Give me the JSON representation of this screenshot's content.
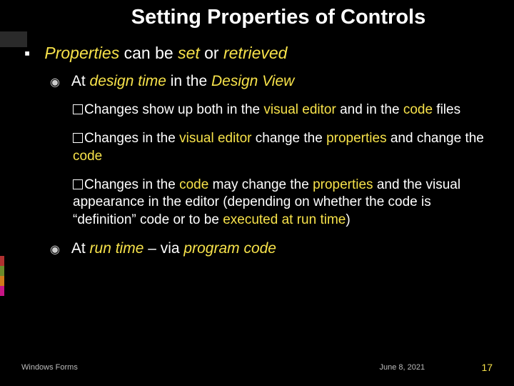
{
  "title": "Setting Properties of Controls",
  "lvl1": {
    "bullet": "▪",
    "pre1": "Properties",
    "mid1": " can be ",
    "pre2": "set",
    "mid2": " or ",
    "pre3": "retrieved"
  },
  "lvl2a": {
    "bullet": "◉",
    "pre": "At ",
    "em1": "design time",
    "mid": " in the ",
    "em2": "Design View"
  },
  "lvl3_items": [
    {
      "segments": [
        {
          "t": "Changes show up both in the ",
          "em": false
        },
        {
          "t": "visual editor",
          "em": true
        },
        {
          "t": " and in the ",
          "em": false
        },
        {
          "t": "code",
          "em": true
        },
        {
          "t": " files",
          "em": false
        }
      ]
    },
    {
      "segments": [
        {
          "t": "Changes in the ",
          "em": false
        },
        {
          "t": "visual editor",
          "em": true
        },
        {
          "t": " change the ",
          "em": false
        },
        {
          "t": "properties",
          "em": true
        },
        {
          "t": " and change the ",
          "em": false
        },
        {
          "t": "code",
          "em": true
        }
      ]
    },
    {
      "segments": [
        {
          "t": "Changes in the ",
          "em": false
        },
        {
          "t": "code",
          "em": true
        },
        {
          "t": " may change the ",
          "em": false
        },
        {
          "t": "properties",
          "em": true
        },
        {
          "t": " and the visual appearance in the editor (depending on whether the code is “definition” code or to be ",
          "em": false
        },
        {
          "t": "executed at run time",
          "em": true
        },
        {
          "t": ")",
          "em": false
        }
      ]
    }
  ],
  "lvl2b": {
    "bullet": "◉",
    "pre": "At ",
    "em1": "run time",
    "mid": " – via ",
    "em2": "program code"
  },
  "footer": {
    "left": "Windows Forms",
    "center": "June 8, 2021",
    "right": "17"
  }
}
